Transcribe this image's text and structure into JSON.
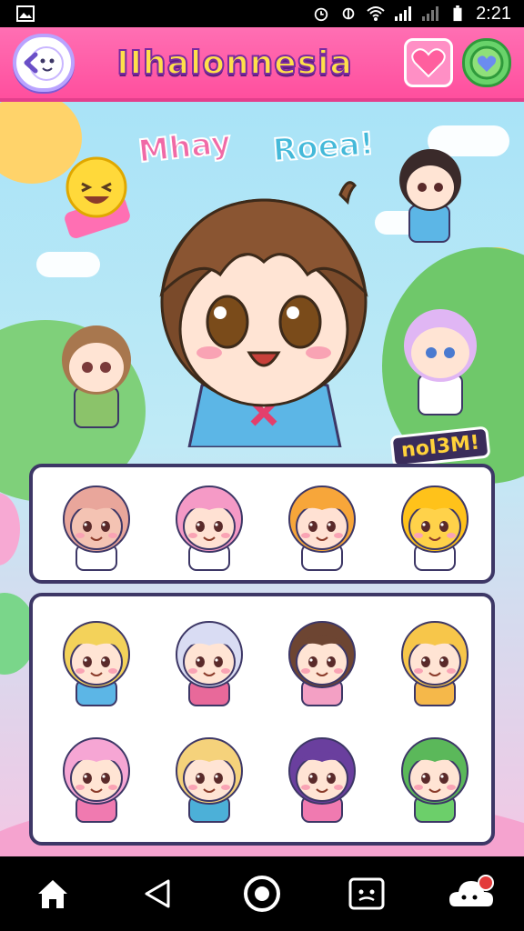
{
  "status_bar": {
    "time": "2:21",
    "icons": [
      "gallery-icon",
      "alarm-icon",
      "signal-icon",
      "wifi-icon",
      "cell-signal-icon",
      "mute-icon",
      "battery-icon"
    ]
  },
  "header": {
    "title": "IIhalonnesia",
    "back_icon": "back-face-icon",
    "heart_icon": "heart-icon",
    "shield_icon": "green-badge-icon"
  },
  "scene": {
    "banner_left": "Mhay",
    "banner_right": "Roea!",
    "tag": "noI3M!"
  },
  "sticker_row": [
    {
      "name": "sticker-blob-heart",
      "skin": "#f4c3b3",
      "hair": "#e9a69b"
    },
    {
      "name": "sticker-pink-girl",
      "skin": "#ffe1d3",
      "hair": "#f59ac6"
    },
    {
      "name": "sticker-orange-buns",
      "skin": "#ffe1d3",
      "hair": "#f7a63a"
    },
    {
      "name": "sticker-yellow-face",
      "skin": "#ffd24a",
      "hair": "#ffc21a"
    }
  ],
  "sticker_grid": [
    {
      "name": "sticker-blonde-bow",
      "hair": "#f3d25a",
      "shirt": "#5cb6e6"
    },
    {
      "name": "sticker-silver-hair",
      "hair": "#d9dcf3",
      "shirt": "#e8699a"
    },
    {
      "name": "sticker-brown-hair",
      "hair": "#6d4532",
      "shirt": "#f3a0c4"
    },
    {
      "name": "sticker-blonde-hearts",
      "hair": "#f7c64a",
      "shirt": "#f5b84a"
    },
    {
      "name": "sticker-pink-pigtails",
      "hair": "#f6a6d4",
      "shirt": "#f07ab0"
    },
    {
      "name": "sticker-yellow-bob",
      "hair": "#f5d27b",
      "shirt": "#4cb0d8"
    },
    {
      "name": "sticker-purple-hair",
      "hair": "#6a3f9e",
      "shirt": "#f07ab0"
    },
    {
      "name": "sticker-green-hair",
      "hair": "#5bb85a",
      "shirt": "#6ccf6a"
    }
  ],
  "nav": [
    {
      "name": "home-button",
      "icon": "home-icon"
    },
    {
      "name": "back-nav-button",
      "icon": "triangle-back-icon"
    },
    {
      "name": "home-circle-button",
      "icon": "circle-icon"
    },
    {
      "name": "sticker-face-button",
      "icon": "sticker-face-icon"
    },
    {
      "name": "notification-button",
      "icon": "cloud-notification-icon"
    }
  ]
}
